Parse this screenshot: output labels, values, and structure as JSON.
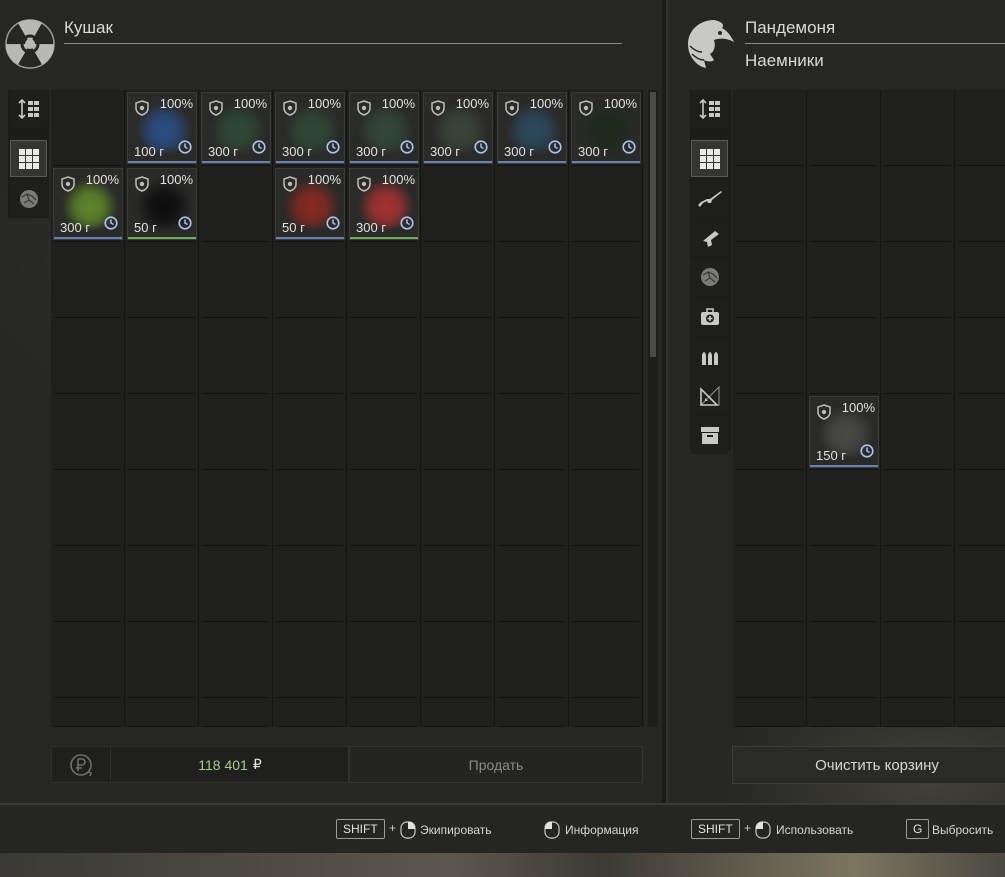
{
  "left_panel": {
    "title": "Кушак",
    "icon": "radiation-icon",
    "tools": [
      "sort-icon",
      "grid-icon",
      "artifact-icon"
    ],
    "items": [
      {
        "col": 1,
        "row": 0,
        "pct": "100%",
        "weight": "100 г",
        "glow": "#2b4f86",
        "line": "#6a7fb8"
      },
      {
        "col": 2,
        "row": 0,
        "pct": "100%",
        "weight": "300 г",
        "glow": "#2f4a34",
        "line": "#6a7fb8"
      },
      {
        "col": 3,
        "row": 0,
        "pct": "100%",
        "weight": "300 г",
        "glow": "#2f4a34",
        "line": "#6a7fb8"
      },
      {
        "col": 4,
        "row": 0,
        "pct": "100%",
        "weight": "300 г",
        "glow": "#34483a",
        "line": "#6a7fb8"
      },
      {
        "col": 5,
        "row": 0,
        "pct": "100%",
        "weight": "300 г",
        "glow": "#3a463a",
        "line": "#6a7fb8"
      },
      {
        "col": 6,
        "row": 0,
        "pct": "100%",
        "weight": "300 г",
        "glow": "#2c4a5e",
        "line": "#6a7fb8"
      },
      {
        "col": 7,
        "row": 0,
        "pct": "100%",
        "weight": "300 г",
        "glow": "#1c2a1c",
        "line": "#6a7fb8"
      },
      {
        "col": 0,
        "row": 1,
        "pct": "100%",
        "weight": "300 г",
        "glow": "#5f8a2a",
        "line": "#6a7fb8"
      },
      {
        "col": 1,
        "row": 1,
        "pct": "100%",
        "weight": "50 г",
        "glow": "#0d0d0d",
        "line": "#6fae5a"
      },
      {
        "col": 3,
        "row": 1,
        "pct": "100%",
        "weight": "50 г",
        "glow": "#8a2a20",
        "line": "#6a7fb8"
      },
      {
        "col": 4,
        "row": 1,
        "pct": "100%",
        "weight": "300 г",
        "glow": "#a83232",
        "line": "#6fae5a"
      }
    ],
    "money": "118 401",
    "currency": "₽",
    "sell_label": "Продать"
  },
  "right_panel": {
    "title": "Пандемоня",
    "subtitle": "Наемники",
    "icon": "eagle-icon",
    "tools": [
      "sort-icon",
      "grid-icon",
      "rifle-icon",
      "pistol-icon",
      "artifact-icon",
      "medkit-icon",
      "ammo-icon",
      "blueprint-icon",
      "box-icon"
    ],
    "items": [
      {
        "col": 1,
        "row": 4,
        "pct": "100%",
        "weight": "150 г",
        "glow": "#4a4a48",
        "line": "#6a7fb8"
      }
    ],
    "clear_label": "Очистить корзину"
  },
  "footer": {
    "key_shift": "SHIFT",
    "key_g": "G",
    "plus": "+",
    "equip": "Экипировать",
    "info": "Информация",
    "use": "Использовать",
    "drop": "Выбросить"
  }
}
